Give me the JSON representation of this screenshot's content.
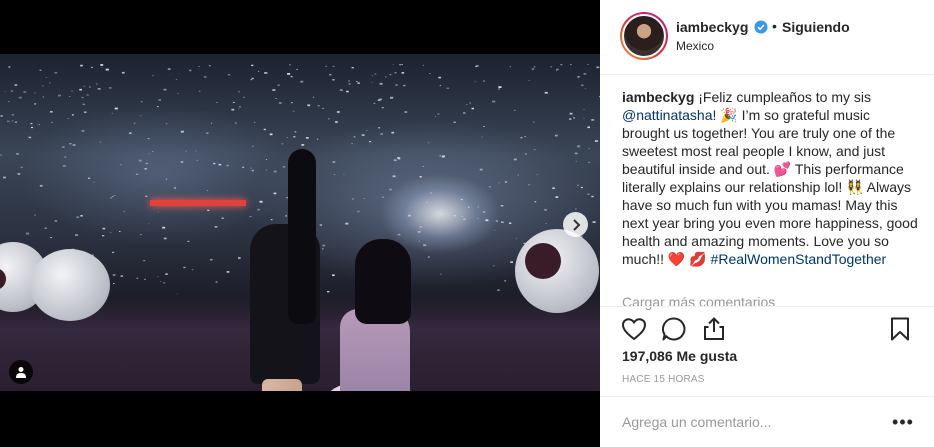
{
  "post": {
    "username": "iambeckyg",
    "separator": "•",
    "follow_label": "Siguiendo",
    "location": "Mexico"
  },
  "caption": {
    "username": "iambeckyg",
    "text_1": "¡Feliz cumpleaños to my sis ",
    "mention": "@nattinatasha",
    "text_2": "! 🎉 I’m so grateful music brought us together! You are truly one of the sweetest most real people I know, and just beautiful inside and out. 💕 This performance literally explains our relationship lol! 👯‍♀️ Always have so much fun with you mamas! May this next year bring you even more happiness, good health and amazing moments. Love you so much!! ❤️ 💋 ",
    "hashtag": "#RealWomenStandTogether"
  },
  "load_more_label": "Cargar más comentarios",
  "likes_label": "197,086 Me gusta",
  "time_label": "HACE 15 HORAS",
  "comment": {
    "placeholder": "Agrega un comentario...",
    "more_label": "•••"
  },
  "carousel": {
    "total": 3,
    "active_index": 0
  },
  "icons": {
    "next": "chevron-right-icon",
    "tag": "user-tag-icon",
    "like": "heart-icon",
    "comment": "comment-icon",
    "share": "share-icon",
    "save": "bookmark-icon",
    "verified": "verified-badge-icon"
  },
  "colors": {
    "link": "#003569",
    "verified": "#3897f0",
    "muted": "#999999",
    "text": "#262626"
  }
}
